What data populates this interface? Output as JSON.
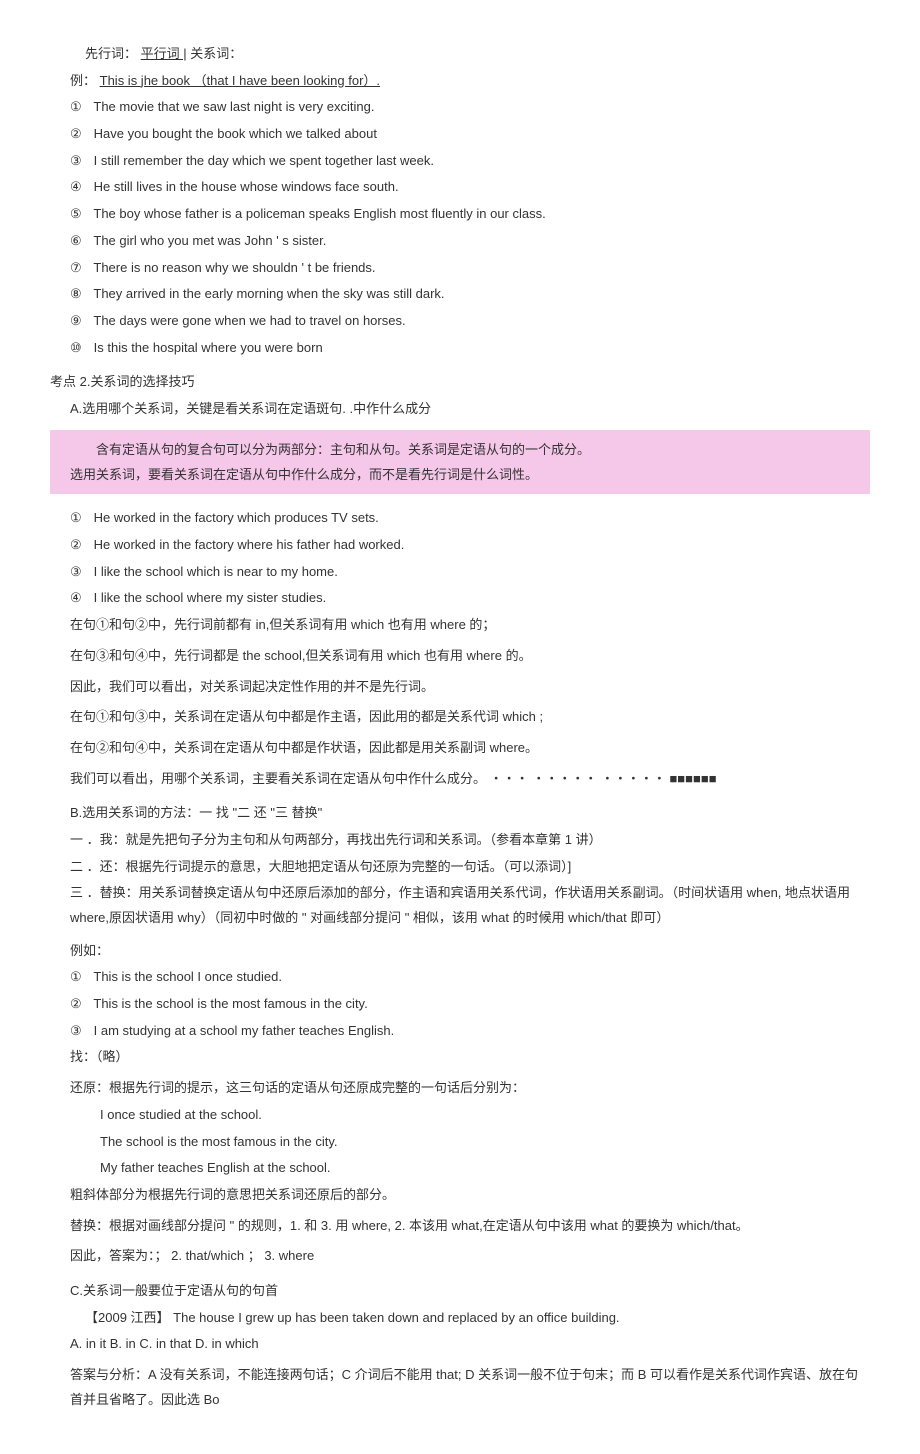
{
  "top": {
    "label_antecedent": "先行词：",
    "label_parallel": "平行词 |",
    "label_relative": "关系词：",
    "example_prefix": "例：",
    "example_sentence": "This is jhe book （that I have been looking for）."
  },
  "list1": [
    "The movie that we saw last night is very exciting.",
    "Have you bought the book which we talked about",
    "I still remember the day which we spent together last week.",
    "He still lives in the house whose windows face south.",
    "The boy whose father is a policeman speaks English most fluently in our class.",
    "The girl who you met was John ' s sister.",
    "There is no reason why we shouldn ' t be friends.",
    "They arrived in the early morning when the sky was still dark.",
    "The days were gone when we had to travel on horses.",
    "Is this the hospital where you were born"
  ],
  "kp2_title": "考点 2.关系词的选择技巧",
  "A_title": "A.选用哪个关系词，关键是看关系词在定语斑句. .中作什么成分",
  "highlight1": "含有定语从句的复合句可以分为两部分：主句和从句。关系词是定语从句的一个成分。",
  "highlight2": "选用关系词，要看关系词在定语从句中作什么成分，而不是看先行词是什么词性。",
  "list2": [
    "He worked in the factory which produces TV sets.",
    "He worked in the factory where his father had worked.",
    "I like the school which is near to my home.",
    "I like the school where my sister studies."
  ],
  "notesA": [
    "在句①和句②中，先行词前都有 in,但关系词有用 which 也有用 where 的；",
    "在句③和句④中，先行词都是 the school,但关系词有用 which 也有用 where 的。",
    "因此，我们可以看出，对关系词起决定性作用的并不是先行词。",
    "在句①和句③中，关系词在定语从句中都是作主语，因此用的都是关系代词 which ;",
    "在句②和句④中，关系词在定语从句中都是作状语，因此都是用关系副词 where。",
    "我们可以看出，用哪个关系词，主要看关系词在定语从句中作什么成分。 ・・・ ・・・・・ ・・・・・ ■■■■■■"
  ],
  "B_title": "B.选用关系词的方法：一 找 \"二 还 \"三 替换\"",
  "B_steps": [
    "一 ．我：就是先把句子分为主句和从句两部分，再找出先行词和关系词。（参看本章第 1 讲）",
    "二 ．还：根据先行词提示的意思，大胆地把定语从句还原为完整的一句话。（可以添词）]",
    "三 ．替换：用关系词替换定语从句中还原后添加的部分，作主语和宾语用关系代词，作状语用关系副词。（时间状语用 when, 地点状语用 where,原因状语用 why）（同初中时做的 \" 对画线部分提问 \" 相似，该用 what 的时候用 which/that 即可）"
  ],
  "B_example_label": "例如：",
  "list3": [
    "This is the school I once studied.",
    "This is the school is the most famous in the city.",
    "I am studying at a school my father teaches English."
  ],
  "find_label": "找：（略）",
  "restore_label": "还原：根据先行词的提示，这三句话的定语从句还原成完整的一句话后分别为：",
  "restored": [
    "I once studied at the school.",
    "The school is the most famous in the city.",
    "My father teaches English at the school."
  ],
  "B_notes": [
    "粗斜体部分为根据先行词的意思把关系词还原后的部分。",
    "替换：根据对画线部分提问 \" 的规则，1. 和 3. 用 where, 2. 本该用 what,在定语从句中该用 what 的要换为 which/that。",
    "因此，答案为：； 2. that/which ； 3. where"
  ],
  "C_title": "C.关系词一般要位于定语从句的句首",
  "C_exam": "【2009 江西】 The house I grew up has been taken down and replaced by an office building.",
  "C_options": "A. in it B. in C. in that D. in which",
  "C_answer": "答案与分析：A 没有关系词，不能连接两句话；C 介词后不能用 that; D 关系词一般不位于句末；而 B 可以看作是关系代词作宾语、放在句首并且省略了。因此选 Bo",
  "circled": [
    "①",
    "②",
    "③",
    "④",
    "⑤",
    "⑥",
    "⑦",
    "⑧",
    "⑨",
    "⑩"
  ]
}
